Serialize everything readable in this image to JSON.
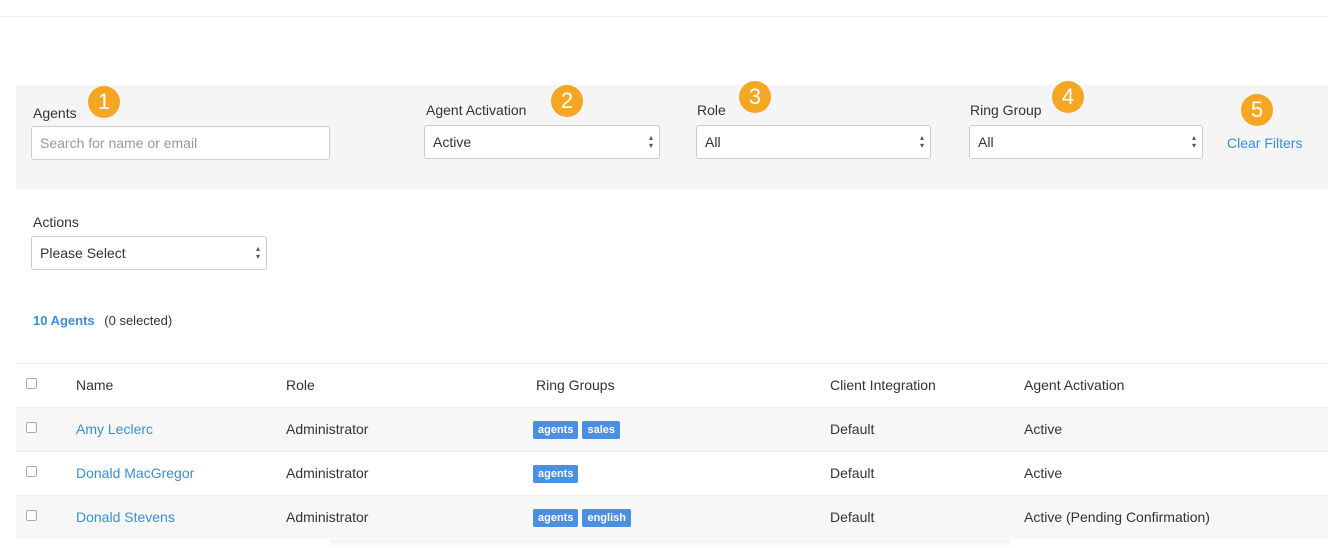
{
  "filters": {
    "agents_label": "Agents",
    "agents_placeholder": "Search for name or email",
    "activation_label": "Agent Activation",
    "activation_value": "Active",
    "role_label": "Role",
    "role_value": "All",
    "ring_group_label": "Ring Group",
    "ring_group_value": "All",
    "clear_filters": "Clear Filters"
  },
  "badges": [
    "1",
    "2",
    "3",
    "4",
    "5"
  ],
  "actions": {
    "label": "Actions",
    "value": "Please Select"
  },
  "summary": {
    "count": "10 Agents",
    "selected": "(0 selected)"
  },
  "table": {
    "headers": {
      "name": "Name",
      "role": "Role",
      "ring_groups": "Ring Groups",
      "client_integration": "Client Integration",
      "agent_activation": "Agent Activation"
    },
    "rows": [
      {
        "name": "Amy Leclerc",
        "role": "Administrator",
        "ring_groups": [
          "agents",
          "sales"
        ],
        "client_integration": "Default",
        "activation": "Active"
      },
      {
        "name": "Donald MacGregor",
        "role": "Administrator",
        "ring_groups": [
          "agents"
        ],
        "client_integration": "Default",
        "activation": "Active"
      },
      {
        "name": "Donald Stevens",
        "role": "Administrator",
        "ring_groups": [
          "agents",
          "english"
        ],
        "client_integration": "Default",
        "activation": "Active (Pending Confirmation)"
      }
    ]
  },
  "colors": {
    "badge": "#f5a623",
    "link": "#3a8fd6",
    "tag": "#4a90e2"
  }
}
